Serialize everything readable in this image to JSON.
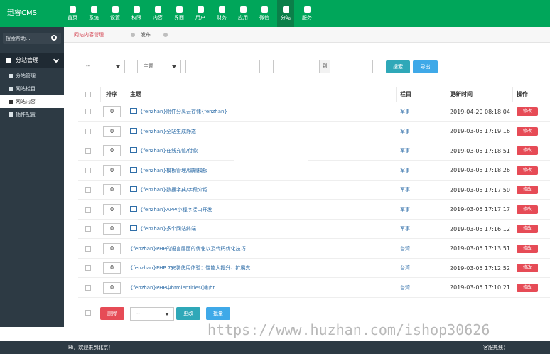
{
  "app": {
    "title": "迅睿CMS"
  },
  "topnav": [
    {
      "label": "首页"
    },
    {
      "label": "系统"
    },
    {
      "label": "设置"
    },
    {
      "label": "权限"
    },
    {
      "label": "内容"
    },
    {
      "label": "界面"
    },
    {
      "label": "用户"
    },
    {
      "label": "财务"
    },
    {
      "label": "应用"
    },
    {
      "label": "微信"
    },
    {
      "label": "分站"
    },
    {
      "label": "服务"
    }
  ],
  "sidebar": {
    "search_placeholder": "搜索帮助...",
    "section": "分站管理",
    "items": [
      {
        "label": "分站管理"
      },
      {
        "label": "网站栏目"
      },
      {
        "label": "网站内容"
      },
      {
        "label": "插件配置"
      }
    ]
  },
  "tabs": [
    {
      "label": "网站内容管理"
    },
    {
      "label": "发布"
    }
  ],
  "filters": {
    "select1": "--",
    "select2": "主题",
    "range_separator": "到",
    "search_button": "搜索",
    "export_button": "导出"
  },
  "table": {
    "headers": [
      "排序",
      "主题",
      "栏目",
      "更新时间",
      "操作"
    ],
    "rows": [
      {
        "order": "0",
        "title": "{fenzhan}附件分离云存储{fenzhan}",
        "category": "军事",
        "time": "2019-04-20 08:18:04",
        "action": "修改",
        "icon": "image-icon"
      },
      {
        "order": "0",
        "title": "{fenzhan}全站生成静态",
        "category": "军事",
        "time": "2019-03-05 17:19:16",
        "action": "修改",
        "icon": "image-icon"
      },
      {
        "order": "0",
        "title": "{fenzhan}在线充值/付款",
        "category": "军事",
        "time": "2019-03-05 17:18:51",
        "action": "修改",
        "icon": "image-icon"
      },
      {
        "order": "0",
        "title": "{fenzhan}模板管理/编辑模板",
        "category": "军事",
        "time": "2019-03-05 17:18:26",
        "action": "修改",
        "icon": "image-icon"
      },
      {
        "order": "0",
        "title": "{fenzhan}数据字典/字段介绍",
        "category": "军事",
        "time": "2019-03-05 17:17:50",
        "action": "修改",
        "icon": "image-icon"
      },
      {
        "order": "0",
        "title": "{fenzhan}APP/小程序接口开发",
        "category": "军事",
        "time": "2019-03-05 17:17:17",
        "action": "修改",
        "icon": "image-icon"
      },
      {
        "order": "0",
        "title": "{fenzhan}多个网站终端",
        "category": "军事",
        "time": "2019-03-05 17:16:12",
        "action": "修改",
        "icon": "image-icon"
      },
      {
        "order": "0",
        "title": "{fenzhan}PHP的语言层面的优化以及代码优化技巧",
        "category": "台湾",
        "time": "2019-03-05 17:13:51",
        "action": "修改",
        "icon": ""
      },
      {
        "order": "0",
        "title": "{fenzhan}PHP 7安装使用体验：性能大提升、扩展支...",
        "category": "台湾",
        "time": "2019-03-05 17:12:52",
        "action": "修改",
        "icon": ""
      },
      {
        "order": "0",
        "title": "{fenzhan}PHP中htmlentities()和ht...",
        "category": "台湾",
        "time": "2019-03-05 17:10:21",
        "action": "修改",
        "icon": ""
      }
    ]
  },
  "bottom": {
    "delete_button": "删除",
    "select": "--",
    "change_button": "更改",
    "batch_button": "批量"
  },
  "footer": {
    "left": "Hi，欢迎来到北京！",
    "right": "客服热线："
  },
  "watermark": "https://www.huzhan.com/ishop30626"
}
